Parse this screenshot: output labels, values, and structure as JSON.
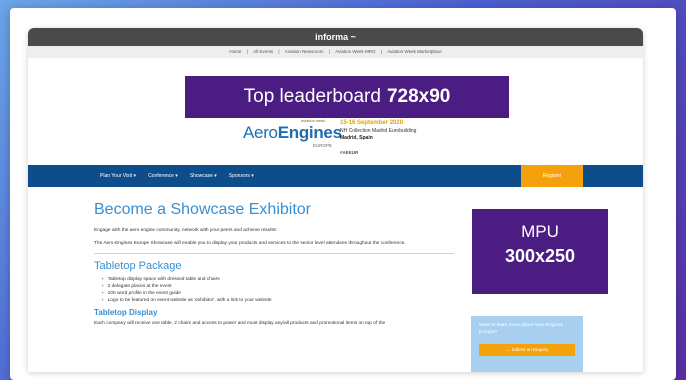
{
  "brand_bar": {
    "title": "informa ~"
  },
  "top_links": [
    "Home",
    "|",
    "All Events",
    "|",
    "Aviation Newsroom",
    "|",
    "Aviation Week MRO",
    "|",
    "Aviation Week Marketplace"
  ],
  "ad_leaderboard": {
    "label": "Top leaderboard",
    "size": "728x90"
  },
  "logo": {
    "mark": "aviation week",
    "name_a": "Aero",
    "name_b": "Engines",
    "sub": "EUROPE"
  },
  "event": {
    "date": "15-16 September 2020",
    "venue": "NH Collection Madrid Eurobuilding",
    "city": "Madrid, Spain",
    "tag": "#AEEUR"
  },
  "nav": {
    "items": [
      "Plan Your Visit ▾",
      "Conference ▾",
      "Showcase ▾",
      "Sponsors ▾"
    ],
    "register": "Register"
  },
  "content": {
    "h1": "Become a Showcase Exhibitor",
    "p1": "Engage with the aero engine community, network with your peers and achieve results!",
    "p2": "The Aero-Engines Europe Showcase will enable you to display your products and services to the senior level attendees throughout the conference.",
    "h2": "Tabletop Package",
    "bullets": [
      "Tabletop display space with dressed table and chairs",
      "2 delegate places at the event",
      "100 word profile in the event guide",
      "Logo to be featured on event website as 'exhibitor', with a link to your website"
    ],
    "h3": "Tabletop Display",
    "p3": "Each company will receive one table, 2 chairs and access to power and must display any/all products and promotional items on top of the"
  },
  "sidebar": {
    "text": "Want to learn more about Aero-Engines Europe?",
    "button": "→ Submit an Enquiry"
  },
  "ad_mpu": {
    "label": "MPU",
    "size": "300x250"
  }
}
